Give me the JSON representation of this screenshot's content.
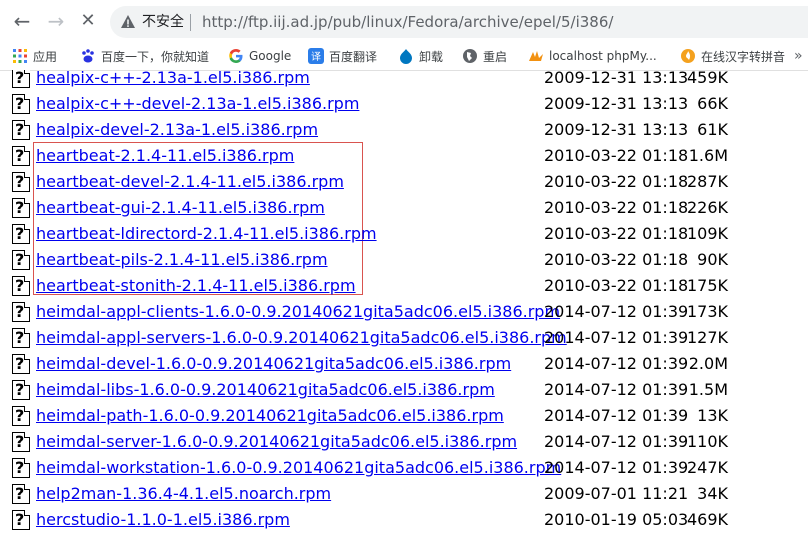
{
  "browser": {
    "nav": {
      "back": "←",
      "forward": "→",
      "reload": "✕"
    },
    "security_label": "不安全",
    "url": "http://ftp.iij.ad.jp/pub/linux/Fedora/archive/epel/5/i386/"
  },
  "bookmarks": [
    {
      "label": "应用",
      "icon": "apps-grid-icon"
    },
    {
      "label": "百度一下，你就知道",
      "icon": "baidu-paw-icon"
    },
    {
      "label": "Google",
      "icon": "google-g-icon"
    },
    {
      "label": "百度翻译",
      "icon": "baidu-translate-icon"
    },
    {
      "label": "卸载",
      "icon": "drupal-drop-icon"
    },
    {
      "label": "重启",
      "icon": "globe-icon"
    },
    {
      "label": "localhost phpMy...",
      "icon": "phpmyadmin-icon"
    },
    {
      "label": "在线汉字转拼音",
      "icon": "flame-icon"
    }
  ],
  "files": [
    {
      "name": "healpix-c++-2.13a-1.el5.i386.rpm",
      "date": "2009-12-31 13:13",
      "size": "459K"
    },
    {
      "name": "healpix-c++-devel-2.13a-1.el5.i386.rpm",
      "date": "2009-12-31 13:13",
      "size": "66K"
    },
    {
      "name": "healpix-devel-2.13a-1.el5.i386.rpm",
      "date": "2009-12-31 13:13",
      "size": "61K"
    },
    {
      "name": "heartbeat-2.1.4-11.el5.i386.rpm",
      "date": "2010-03-22 01:18",
      "size": "1.6M"
    },
    {
      "name": "heartbeat-devel-2.1.4-11.el5.i386.rpm",
      "date": "2010-03-22 01:18",
      "size": "287K"
    },
    {
      "name": "heartbeat-gui-2.1.4-11.el5.i386.rpm",
      "date": "2010-03-22 01:18",
      "size": "226K"
    },
    {
      "name": "heartbeat-ldirectord-2.1.4-11.el5.i386.rpm",
      "date": "2010-03-22 01:18",
      "size": "109K"
    },
    {
      "name": "heartbeat-pils-2.1.4-11.el5.i386.rpm",
      "date": "2010-03-22 01:18",
      "size": "90K"
    },
    {
      "name": "heartbeat-stonith-2.1.4-11.el5.i386.rpm",
      "date": "2010-03-22 01:18",
      "size": "175K"
    },
    {
      "name": "heimdal-appl-clients-1.6.0-0.9.20140621gita5adc06.el5.i386.rpm",
      "date": "2014-07-12 01:39",
      "size": "173K"
    },
    {
      "name": "heimdal-appl-servers-1.6.0-0.9.20140621gita5adc06.el5.i386.rpm",
      "date": "2014-07-12 01:39",
      "size": "127K"
    },
    {
      "name": "heimdal-devel-1.6.0-0.9.20140621gita5adc06.el5.i386.rpm",
      "date": "2014-07-12 01:39",
      "size": "2.0M"
    },
    {
      "name": "heimdal-libs-1.6.0-0.9.20140621gita5adc06.el5.i386.rpm",
      "date": "2014-07-12 01:39",
      "size": "1.5M"
    },
    {
      "name": "heimdal-path-1.6.0-0.9.20140621gita5adc06.el5.i386.rpm",
      "date": "2014-07-12 01:39",
      "size": "13K"
    },
    {
      "name": "heimdal-server-1.6.0-0.9.20140621gita5adc06.el5.i386.rpm",
      "date": "2014-07-12 01:39",
      "size": "110K"
    },
    {
      "name": "heimdal-workstation-1.6.0-0.9.20140621gita5adc06.el5.i386.rpm",
      "date": "2014-07-12 01:39",
      "size": "247K"
    },
    {
      "name": "help2man-1.36.4-4.1.el5.noarch.rpm",
      "date": "2009-07-01 11:21",
      "size": "34K"
    },
    {
      "name": "hercstudio-1.1.0-1.el5.i386.rpm",
      "date": "2010-01-19 05:03",
      "size": "469K"
    }
  ],
  "unknown_file_icon_glyph": "?",
  "colors": {
    "link": "#0000ee",
    "highlight_border": "#d9534f"
  }
}
